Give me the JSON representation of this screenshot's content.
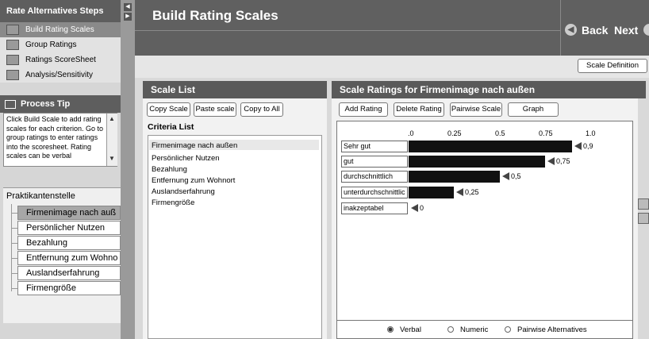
{
  "sidebar": {
    "steps_title": "Rate Alternatives Steps",
    "steps": [
      {
        "label": "Build Rating Scales",
        "icon": "rating-scale-icon"
      },
      {
        "label": "Group Ratings",
        "icon": "group-ratings-icon"
      },
      {
        "label": "Ratings ScoreSheet",
        "icon": "scoresheet-icon"
      },
      {
        "label": "Analysis/Sensitivity",
        "icon": "analysis-icon"
      }
    ],
    "tip_title": "Process Tip",
    "tip_text": "Click Build Scale to add rating scales for each criterion. Go to group ratings to enter ratings into the scoresheet. Rating scales can be verbal",
    "tree_root": "Praktikantenstelle",
    "tree_items": [
      "Firmenimage nach auß",
      "Persönlicher Nutzen",
      "Bezahlung",
      "Entfernung zum Wohno",
      "Auslandserfahrung",
      "Firmengröße"
    ]
  },
  "header": {
    "title": "Build Rating Scales",
    "back_label": "Back",
    "next_label": "Next",
    "scale_definition_label": "Scale Definition"
  },
  "scale_list": {
    "title": "Scale List",
    "buttons": [
      "Copy Scale",
      "Paste scale",
      "Copy to All"
    ],
    "criteria_title": "Criteria List",
    "criteria": [
      "Firmenimage nach außen",
      "Persönlicher Nutzen",
      "Bezahlung",
      "Entfernung zum Wohnort",
      "Auslandserfahrung",
      "Firmengröße"
    ]
  },
  "ratings": {
    "title": "Scale Ratings for Firmenimage nach außen",
    "buttons": [
      "Add Rating",
      "Delete Rating",
      "Pairwise Scale",
      "Graph"
    ],
    "ticks": [
      ".0",
      "0.25",
      "0.5",
      "0.75",
      "1.0"
    ],
    "levels": [
      {
        "label": "Sehr gut",
        "value": 0.9,
        "display": "0,9"
      },
      {
        "label": "gut",
        "value": 0.75,
        "display": "0,75"
      },
      {
        "label": "durchschnittlich",
        "value": 0.5,
        "display": "0,5"
      },
      {
        "label": "unterdurchschnittlic",
        "value": 0.25,
        "display": "0,25"
      },
      {
        "label": "inakzeptabel",
        "value": 0,
        "display": "0"
      }
    ],
    "scale_types": [
      {
        "label": "Verbal",
        "selected": true
      },
      {
        "label": "Numeric",
        "selected": false
      },
      {
        "label": "Pairwise Alternatives",
        "selected": false
      }
    ]
  }
}
